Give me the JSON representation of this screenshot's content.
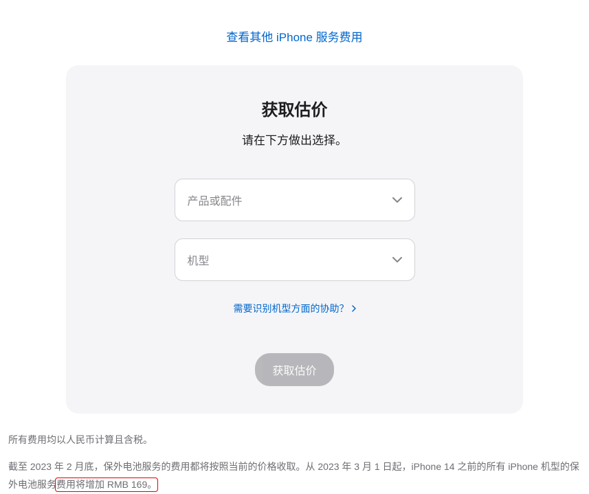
{
  "topLink": {
    "label": "查看其他 iPhone 服务费用"
  },
  "card": {
    "title": "获取估价",
    "subtitle": "请在下方做出选择。",
    "select1": {
      "placeholder": "产品或配件"
    },
    "select2": {
      "placeholder": "机型"
    },
    "helpLink": "需要识别机型方面的协助？",
    "submitButton": "获取估价"
  },
  "footer": {
    "line1": "所有费用均以人民币计算且含税。",
    "line2_part1": "截至 2023 年 2 月底，保外电池服务的费用都将按照当前的价格收取。从 2023 年 3 月 1 日起，iPhone 14 之前的所有 iPhone 机型的保外电池服务",
    "line2_highlight": "费用将增加 RMB 169。"
  }
}
